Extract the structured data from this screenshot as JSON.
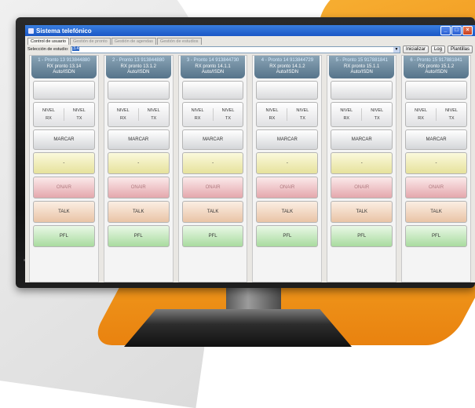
{
  "window": {
    "title": "Sistema telefónico"
  },
  "tabs": [
    {
      "label": "Control de usuario",
      "active": true
    },
    {
      "label": "Gestión de pronto",
      "active": false
    },
    {
      "label": "Gestión de agendas",
      "active": false
    },
    {
      "label": "Gestión de estudios",
      "active": false
    }
  ],
  "studio_select": {
    "label": "Selección de estudio:",
    "value": "3.4"
  },
  "toolbar": {
    "init_label": "Inicializar",
    "log_label": "Log",
    "templates_label": "Plantillas"
  },
  "channels": [
    {
      "line1": "1 - Pronto 13 913844880",
      "line2": "RX pronto 13.14",
      "line3": "Auto/ISDN"
    },
    {
      "line1": "2 - Pronto 13 913844880",
      "line2": "RX pronto 13.1.2",
      "line3": "Auto/ISDN"
    },
    {
      "line1": "3 - Pronto 14 913844730",
      "line2": "RX pronto 14.1.1",
      "line3": "Auto/ISDN"
    },
    {
      "line1": "4 - Pronto 14 913844729",
      "line2": "RX pronto 14.1.2",
      "line3": "Auto/ISDN"
    },
    {
      "line1": "5 - Pronto 15 917881841",
      "line2": "RX pronto 15.1.1",
      "line3": "Auto/ISDN"
    },
    {
      "line1": "6 - Pronto 15 917881841",
      "line2": "RX pronto 15.1.2",
      "line3": "Auto/ISDN"
    }
  ],
  "buttons": {
    "nivel": "NIVEL",
    "rx": "RX",
    "tx": "TX",
    "marcar": "MARCAR",
    "dash": "-",
    "onair": "ONAIR",
    "talk": "TALK",
    "pfl": "PFL"
  },
  "colors": {
    "accent_orange": "#ef8a12",
    "titlebar_blue": "#1a57c6",
    "header_steel": "#56748a"
  }
}
